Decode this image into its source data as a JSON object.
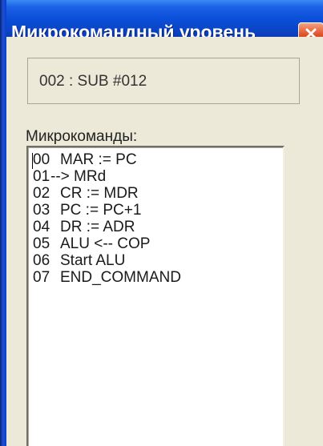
{
  "window": {
    "title": "Микрокомандный уровень",
    "close_icon": "close-icon",
    "colors": {
      "titlebar": "#0b4fd9",
      "close": "#e0512a",
      "client": "#ece9d8"
    }
  },
  "command": {
    "value": "002 : SUB #012"
  },
  "microcommands": {
    "label": "Микрокоманды:",
    "rows": [
      {
        "num": "00",
        "cmd": "MAR := PC"
      },
      {
        "num": "01",
        "cmd": "--> MRd"
      },
      {
        "num": "02",
        "cmd": "CR := MDR"
      },
      {
        "num": "03",
        "cmd": "PC := PC+1"
      },
      {
        "num": "04",
        "cmd": "DR := ADR"
      },
      {
        "num": "05",
        "cmd": "ALU <-- COP"
      },
      {
        "num": "06",
        "cmd": "Start ALU"
      },
      {
        "num": "07",
        "cmd": "END_COMMAND"
      }
    ]
  }
}
